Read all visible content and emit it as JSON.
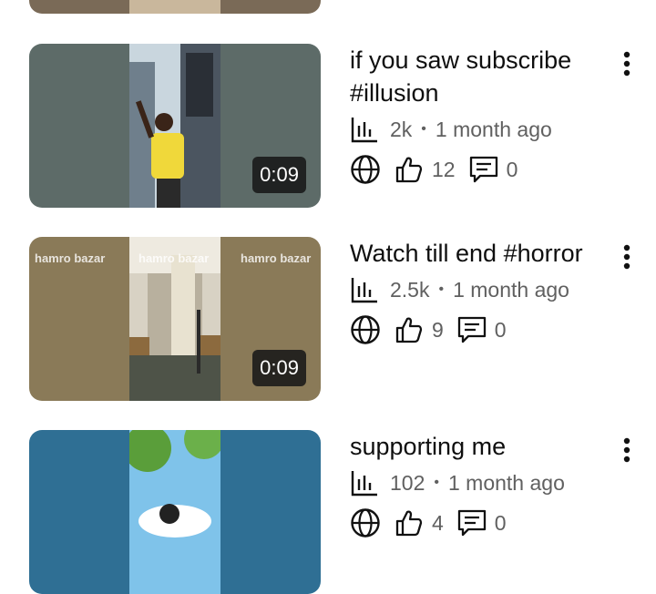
{
  "videos": [
    {
      "title": "if you saw subscribe #illusion",
      "views": "2k",
      "age": "1 month ago",
      "likes": "12",
      "comments": "0",
      "duration": "0:09",
      "thumb_color": "#5d6b68"
    },
    {
      "title": "Watch till end #horror",
      "views": "2.5k",
      "age": "1 month ago",
      "likes": "9",
      "comments": "0",
      "duration": "0:09",
      "thumb_color": "#8a7a58",
      "watermark": "hamro bazar"
    },
    {
      "title": "supporting me",
      "views": "102",
      "age": "1 month ago",
      "likes": "4",
      "comments": "0",
      "duration": "",
      "thumb_color": "#2f6f94"
    }
  ],
  "separator": "•",
  "icons": {
    "stats": "bar-chart-icon",
    "visibility": "globe-icon",
    "like": "thumbs-up-icon",
    "comment": "comment-icon",
    "more": "more-vertical-icon"
  }
}
